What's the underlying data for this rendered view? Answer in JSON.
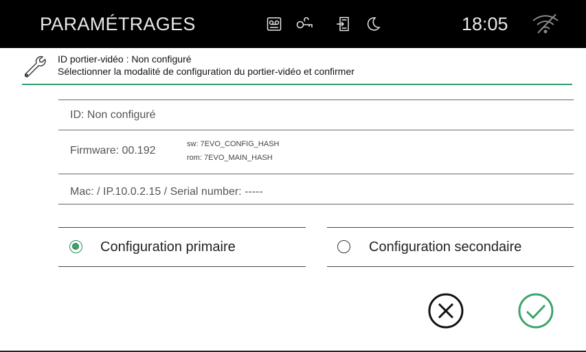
{
  "topbar": {
    "title": "PARAMÉTRAGES",
    "time": "18:05",
    "icons": [
      "voicemail-icon",
      "key-icon",
      "door-entry-icon",
      "moon-icon",
      "wifi-off-icon"
    ],
    "background": "#000000"
  },
  "header": {
    "icon": "wrench-icon",
    "line1": "ID portier-vidéo : Non configuré",
    "line2": "Sélectionner la modalité de configuration du portier-vidéo et confirmer",
    "accent": "#2f9e6b"
  },
  "info": {
    "id": "ID: Non configuré",
    "firmware": "Firmware: 00.192",
    "sw": "sw: 7EVO_CONFIG_HASH",
    "rom": "rom: 7EVO_MAIN_HASH",
    "mac": "Mac:  / IP.10.0.2.15 / Serial number: -----"
  },
  "options": {
    "primary": {
      "label": "Configuration primaire",
      "selected": true
    },
    "secondary": {
      "label": "Configuration secondaire",
      "selected": false
    }
  },
  "actions": {
    "cancel_icon": "cancel-icon",
    "confirm_icon": "confirm-icon",
    "confirm_color": "#3aa46a"
  }
}
